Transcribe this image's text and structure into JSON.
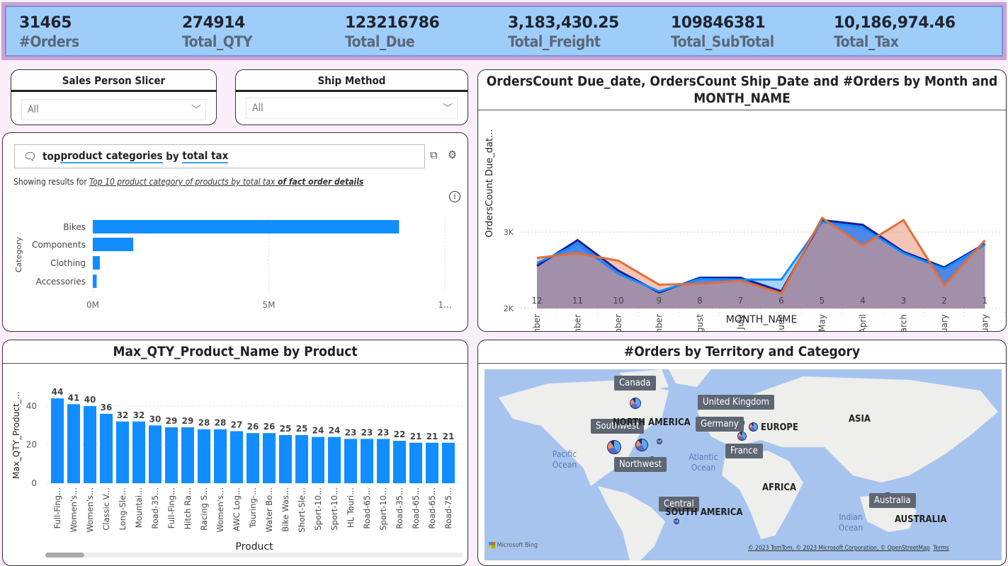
{
  "kpis": [
    {
      "value": "31465",
      "label": "#Orders"
    },
    {
      "value": "274914",
      "label": "Total_QTY"
    },
    {
      "value": "123216786",
      "label": "Total_Due"
    },
    {
      "value": "3,183,430.25",
      "label": "Total_Freight"
    },
    {
      "value": "109846381",
      "label": "Total_SubTotal"
    },
    {
      "value": "10,186,974.46",
      "label": "Total_Tax"
    }
  ],
  "slicers": [
    {
      "title": "Sales Person Slicer",
      "value": "All"
    },
    {
      "title": "Ship Method",
      "value": "All"
    }
  ],
  "qa": {
    "question_parts": [
      "top ",
      "product categories",
      " by ",
      "total tax"
    ],
    "showing_prefix": "Showing results for ",
    "showing_link": "Top 10 product category of products by total tax",
    "showing_suffix": " of fact order details"
  },
  "colors": {
    "bar": "#118dff",
    "navy": "#12239e",
    "orange": "#e66c37",
    "kpi_bg": "#9fcdfa"
  },
  "chart_data": [
    {
      "type": "bar",
      "orientation": "horizontal",
      "categories": [
        "Bikes",
        "Components",
        "Clothing",
        "Accessories"
      ],
      "values": [
        8700000,
        1150000,
        200000,
        110000
      ],
      "ylabel": "Category",
      "ticks": [
        "0M",
        "5M",
        "1..."
      ],
      "xlim": [
        0,
        10000000
      ]
    },
    {
      "type": "area",
      "title": "OrdersCount Due_date, OrdersCount Ship_Date and #Orders by Month and MONTH_NAME",
      "xlabel": "MONTH_NAME",
      "ylabel": "OrdersCount Due_dat...",
      "categories": [
        "December",
        "November",
        "October",
        "September",
        "August",
        "July",
        "June",
        "May",
        "April",
        "March",
        "February",
        "January"
      ],
      "month_numbers": [
        "12",
        "11",
        "10",
        "9",
        "8",
        "7",
        "6",
        "5",
        "4",
        "3",
        "2",
        "1"
      ],
      "yticks": [
        "3K",
        "2K"
      ],
      "ylim": [
        2000,
        3400
      ],
      "series": [
        {
          "color": "#12239e",
          "values": [
            2557,
            2895,
            2495,
            2209,
            2403,
            2403,
            2225,
            3157,
            3095,
            2742,
            2538,
            2846
          ]
        },
        {
          "color": "#118dff",
          "values": [
            2594,
            2840,
            2455,
            2225,
            2385,
            2378,
            2378,
            3132,
            3055,
            2723,
            2517,
            2834
          ]
        },
        {
          "color": "#e66c37",
          "values": [
            2662,
            2723,
            2625,
            2311,
            2323,
            2363,
            2200,
            3185,
            2825,
            3157,
            2302,
            2892
          ]
        }
      ]
    },
    {
      "type": "bar",
      "title": "Max_QTY_Product_Name by Product",
      "xlabel": "Product",
      "ylabel": "Max_QTY_Product_...",
      "yticks": [
        0,
        20,
        40
      ],
      "ylim": [
        0,
        48
      ],
      "categories": [
        "Full-Fing...",
        "Women's...",
        "Women's...",
        "Classic V...",
        "Long-Sle...",
        "Mountai...",
        "Road-35...",
        "Full-Fing...",
        "Hitch Ra...",
        "Racing S...",
        "Women's...",
        "AWC Log...",
        "Touring-...",
        "Water Bo...",
        "Bike Was...",
        "Short-Sle...",
        "Sport-10...",
        "Sport-10...",
        "HL Touri...",
        "Road-65...",
        "Sport-10...",
        "Road-35...",
        "Road-65...",
        "Road-65...",
        "Road-75..."
      ],
      "values": [
        44,
        41,
        40,
        36,
        32,
        32,
        30,
        29,
        29,
        28,
        28,
        27,
        26,
        26,
        25,
        25,
        24,
        24,
        23,
        23,
        23,
        22,
        21,
        21,
        21
      ]
    }
  ],
  "map": {
    "title": "#Orders by Territory and Category",
    "territories": [
      "Canada",
      "United Kingdom",
      "Southwest",
      "Germany",
      "France",
      "Northwest",
      "Central",
      "Australia"
    ],
    "continents": [
      "NORTH AMERICA",
      "EUROPE",
      "ASIA",
      "AFRICA",
      "SOUTH AMERICA",
      "AUSTRALIA"
    ],
    "oceans": [
      "Pacific Ocean",
      "Atlantic Ocean",
      "Indian Ocean"
    ],
    "attribution": "© 2023 TomTom, © 2023 Microsoft Corporation, © OpenStreetMap",
    "terms": "Terms",
    "logo": "Microsoft Bing"
  }
}
